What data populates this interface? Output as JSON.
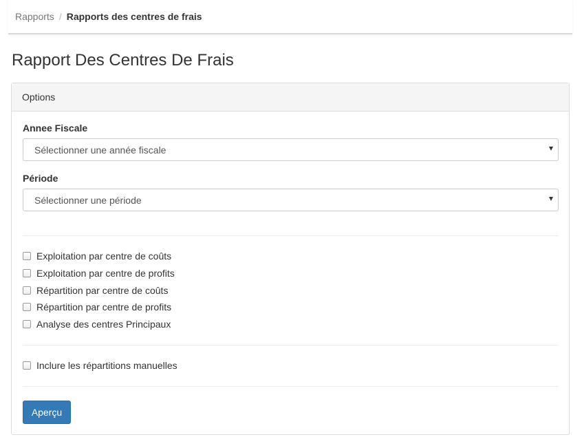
{
  "breadcrumb": {
    "parent": "Rapports",
    "separator": "/",
    "current": "Rapports des centres de frais"
  },
  "page": {
    "title": "Rapport Des Centres De Frais"
  },
  "panel": {
    "heading": "Options",
    "fiscal_year": {
      "label": "Annee Fiscale",
      "placeholder": "Sélectionner une année fiscale"
    },
    "period": {
      "label": "Période",
      "placeholder": "Sélectionner une période"
    },
    "report_options": [
      {
        "label": "Exploitation par centre de coûts",
        "checked": false
      },
      {
        "label": "Exploitation par centre de profits",
        "checked": false
      },
      {
        "label": "Répartition par centre de coûts",
        "checked": false
      },
      {
        "label": "Répartition par centre de profits",
        "checked": false
      },
      {
        "label": "Analyse des centres Principaux",
        "checked": false
      }
    ],
    "manual_allocations": {
      "label": "Inclure les répartitions manuelles",
      "checked": false
    },
    "preview_button": "Aperçu"
  },
  "colors": {
    "primary": "#337ab7",
    "panel_heading_bg": "#f5f5f5",
    "border": "#dddddd",
    "text": "#333333"
  },
  "icons": {
    "select_caret": "caret-down-icon",
    "checkbox": "checkbox-unchecked-icon"
  }
}
